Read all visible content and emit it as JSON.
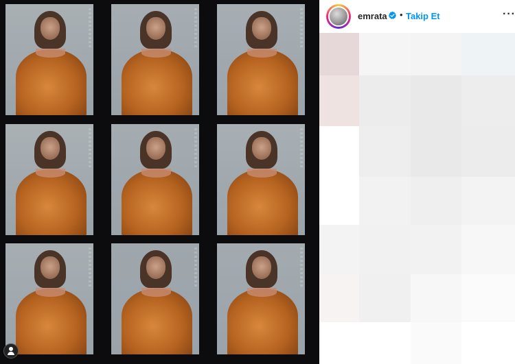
{
  "post": {
    "image_alt": "photo contact sheet",
    "frames": [
      {
        "shade": "#a9b0b4"
      },
      {
        "shade": "#a6adb2"
      },
      {
        "shade": "#a7aeb3"
      },
      {
        "shade": "#aab1b5"
      },
      {
        "shade": "#a4acb1"
      },
      {
        "shade": "#a8afb4"
      },
      {
        "shade": "#a6aeb2"
      },
      {
        "shade": "#9fa7ad"
      },
      {
        "shade": "#a3abb0"
      }
    ]
  },
  "header": {
    "username": "emrata",
    "dot": "•",
    "follow_label": "Takip Et",
    "more_label": "···"
  },
  "colors": {
    "follow": "#0095f6",
    "verified": "#0095f6",
    "blur_cells": [
      "#e6d7d8",
      "#f5f5f5",
      "#f4f4f4",
      "#eef3f6",
      "#eee3e1",
      "#ececec",
      "#e9e9e9",
      "#ededed",
      "#ffffff",
      "#eeeeee",
      "#e9e9e9",
      "#ececec",
      "#ffffff",
      "#f2f2f2",
      "#efefef",
      "#f3f3f3",
      "#f3f3f3",
      "#f1f1f1",
      "#f2f2f2",
      "#f7f7f7",
      "#f6f3f2",
      "#f0f0f0",
      "#f7f7f7",
      "#fbfbfb",
      "#ffffff",
      "#ffffff",
      "#fafafa",
      "#ffffff"
    ]
  }
}
